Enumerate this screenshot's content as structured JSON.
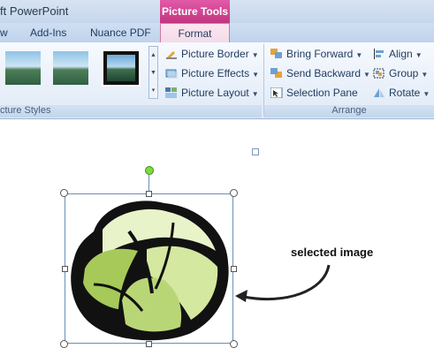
{
  "window": {
    "app_title": "ft PowerPoint",
    "context_tab_title": "Picture Tools"
  },
  "tabs": [
    {
      "label": "w"
    },
    {
      "label": "Add-Ins"
    },
    {
      "label": "Nuance PDF"
    },
    {
      "label": "Format"
    }
  ],
  "ribbon": {
    "picture_styles": {
      "label": "cture Styles"
    },
    "picture_group": {
      "commands": [
        {
          "label": "Picture Border",
          "icon": "pencil-icon"
        },
        {
          "label": "Picture Effects",
          "icon": "effects-icon"
        },
        {
          "label": "Picture Layout",
          "icon": "layout-icon"
        }
      ]
    },
    "arrange": {
      "label": "Arrange",
      "commands_left": [
        {
          "label": "Bring Forward",
          "icon": "bring-forward-icon"
        },
        {
          "label": "Send Backward",
          "icon": "send-backward-icon"
        },
        {
          "label": "Selection Pane",
          "icon": "selection-pane-icon"
        }
      ],
      "commands_right": [
        {
          "label": "Align",
          "icon": "align-icon"
        },
        {
          "label": "Group",
          "icon": "group-icon"
        },
        {
          "label": "Rotate",
          "icon": "rotate-icon"
        }
      ]
    }
  },
  "colors": {
    "context_accent": "#c2357f",
    "ribbon": "#dfe9f6",
    "selection_border": "#6a8fb8",
    "rotation_handle": "#7ddc3c"
  },
  "canvas": {
    "annotation": "selected image"
  }
}
